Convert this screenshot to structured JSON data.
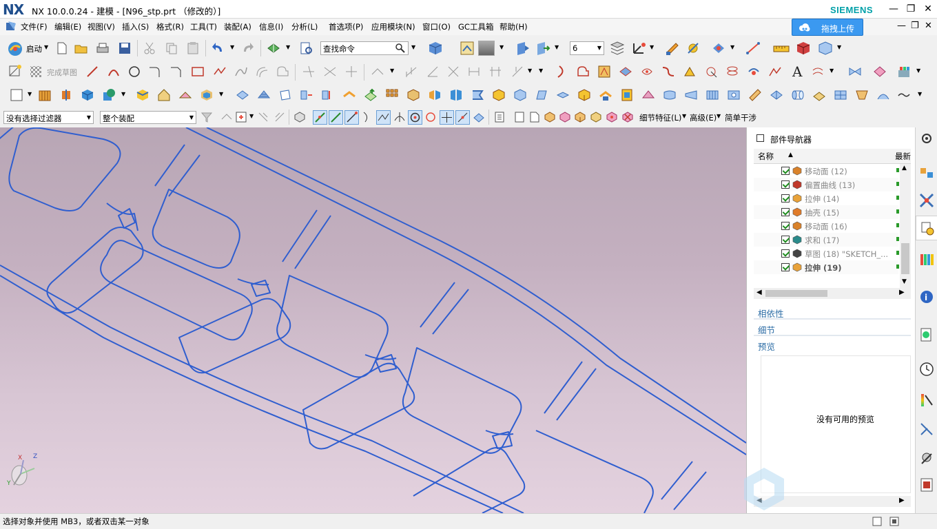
{
  "window": {
    "logo": "NX",
    "title": "NX 10.0.0.24 - 建模 - [N96_stp.prt （修改的）]",
    "brand": "SIEMENS",
    "controls": [
      "—",
      "❐",
      "✕"
    ]
  },
  "menubar": {
    "items": [
      "文件(F)",
      "编辑(E)",
      "视图(V)",
      "插入(S)",
      "格式(R)",
      "工具(T)",
      "装配(A)",
      "信息(I)",
      "分析(L)",
      "首选项(P)",
      "应用模块(N)",
      "窗口(O)",
      "GC工具箱",
      "帮助(H)"
    ],
    "upload_button": "拖拽上传",
    "mdi_controls": [
      "—",
      "❐",
      "✕"
    ]
  },
  "toolbar1": {
    "start_label": "启动",
    "search_placeholder": "查找命令",
    "layer_value": "6"
  },
  "toolbar2": {
    "finish_sketch": "完成草图"
  },
  "toolbar4": {
    "filter_value": "没有选择过滤器",
    "assembly_value": "整个装配",
    "detail_feature": "细节特征(L)",
    "advanced": "高级(E)",
    "simple_interference": "简单干涉"
  },
  "viewport": {
    "triad": {
      "x": "X",
      "y": "Y",
      "z": "Z"
    }
  },
  "navigator": {
    "title": "部件导航器",
    "col_name": "名称",
    "col_latest": "最新",
    "rows": [
      {
        "label": "移动面 (12)",
        "icon": "move-face-icon",
        "color": "#d9822b",
        "active": false
      },
      {
        "label": "偏置曲线 (13)",
        "icon": "offset-curve-icon",
        "color": "#c0392b",
        "active": false
      },
      {
        "label": "拉伸 (14)",
        "icon": "extrude-icon",
        "color": "#e8a23a",
        "active": false
      },
      {
        "label": "抽壳 (15)",
        "icon": "shell-icon",
        "color": "#e07b2a",
        "active": false
      },
      {
        "label": "移动面 (16)",
        "icon": "move-face-icon",
        "color": "#d9822b",
        "active": false
      },
      {
        "label": "求和 (17)",
        "icon": "unite-icon",
        "color": "#2a8a8a",
        "active": false
      },
      {
        "label": "草图 (18) \"SKETCH_...",
        "icon": "sketch-icon",
        "color": "#444444",
        "active": false
      },
      {
        "label": "拉伸 (19)",
        "icon": "extrude-icon",
        "color": "#e8a23a",
        "active": true
      }
    ],
    "sections": [
      "相依性",
      "细节",
      "预览"
    ],
    "preview_empty": "没有可用的预览"
  },
  "statusbar": {
    "prompt": "选择对象并使用 MB3，或者双击某一对象"
  },
  "colors": {
    "accent": "#3b99f0",
    "curve": "#2f5ecf",
    "section_text": "#2e6ea6"
  }
}
